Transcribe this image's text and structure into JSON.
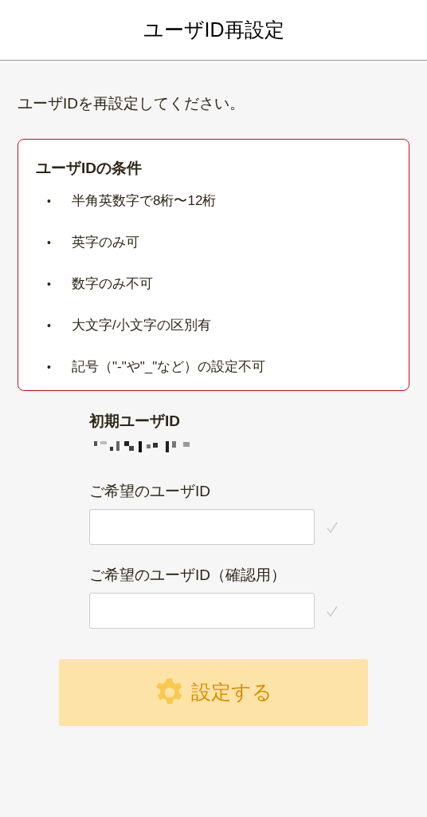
{
  "header": {
    "title": "ユーザID再設定"
  },
  "instruction": "ユーザIDを再設定してください。",
  "conditions": {
    "title": "ユーザIDの条件",
    "items": [
      {
        "bullet": "•",
        "text": "半角英数字で8桁〜12桁"
      },
      {
        "bullet": "•",
        "text": "英字のみ可"
      },
      {
        "bullet": "•",
        "text": "数字のみ不可"
      },
      {
        "bullet": "•",
        "text": "大文字/小文字の区別有"
      },
      {
        "bullet": "•",
        "text": "記号（\"-\"や\"_\"など）の設定不可"
      }
    ]
  },
  "initial_id": {
    "label": "初期ユーザID"
  },
  "fields": [
    {
      "label": "ご希望のユーザID"
    },
    {
      "label": "ご希望のユーザID（確認用）"
    }
  ],
  "submit": {
    "label": "設定する",
    "disabled": true
  }
}
